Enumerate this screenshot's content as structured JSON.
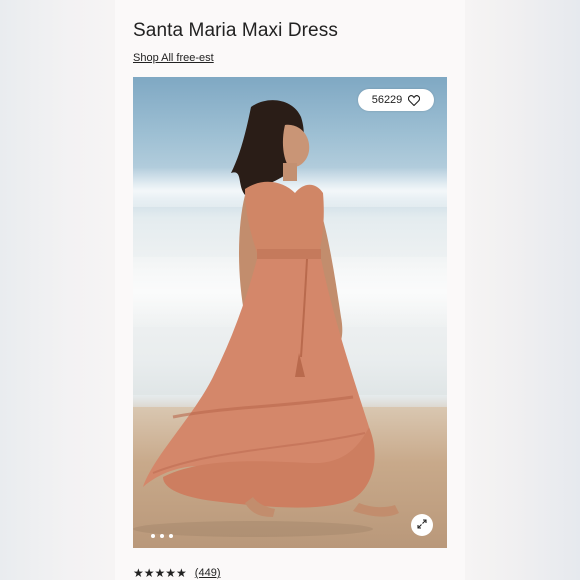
{
  "product": {
    "title": "Santa Maria Maxi Dress",
    "shop_link": "Shop All free-est"
  },
  "photo": {
    "like_count": "56229",
    "like_icon": "heart-outline-icon",
    "expand_icon": "expand-icon",
    "carousel_dots": 3
  },
  "rating": {
    "stars": "★★★★★",
    "value": 4.5,
    "max": 5,
    "review_count_label": "(449)"
  },
  "colors": {
    "dress": "#d4876a",
    "text": "#222222"
  }
}
